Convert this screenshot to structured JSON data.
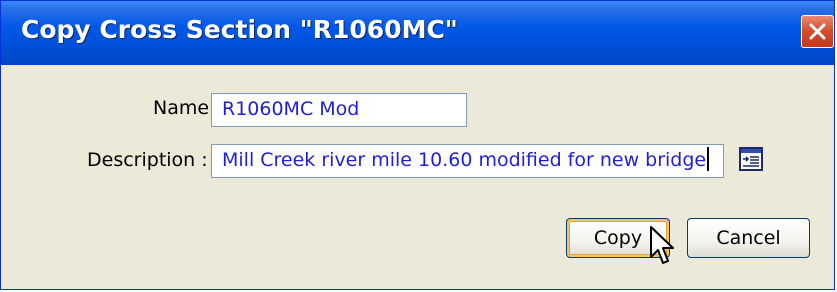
{
  "window": {
    "title": "Copy Cross Section \"R1060MC\""
  },
  "form": {
    "name_label": "Name :",
    "name_value": "R1060MC Mod",
    "description_label": "Description :",
    "description_value": "Mill Creek river mile 10.60 modified for new bridge"
  },
  "buttons": {
    "copy_label": "Copy",
    "cancel_label": "Cancel"
  },
  "icons": {
    "close": "close-icon",
    "description_editor": "text-editor-icon",
    "cursor": "mouse-pointer-icon"
  },
  "colors": {
    "titlebar": "#0058e8",
    "dialog_bg": "#ece9d8",
    "field_text": "#1f1fd8",
    "close_button": "#d6492c"
  }
}
